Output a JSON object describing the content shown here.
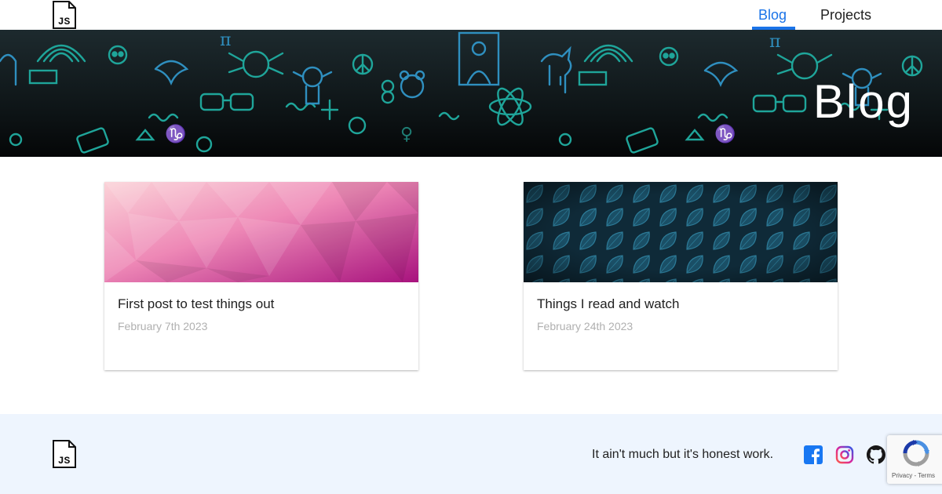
{
  "nav": {
    "logo_text": "JS",
    "links": [
      {
        "label": "Blog",
        "active": true
      },
      {
        "label": "Projects",
        "active": false
      }
    ]
  },
  "hero": {
    "title": "Blog"
  },
  "posts": [
    {
      "title": "First post to test things out",
      "date": "February 7th 2023",
      "thumbnail": "pink-lowpoly-pattern"
    },
    {
      "title": "Things I read and watch",
      "date": "February 24th 2023",
      "thumbnail": "dark-blue-leaf-pattern"
    }
  ],
  "footer": {
    "logo_text": "JS",
    "tagline": "It ain't much but it's honest work.",
    "social": [
      {
        "icon": "facebook-icon",
        "color": "#1877f2"
      },
      {
        "icon": "instagram-icon",
        "color": "#e1306c"
      },
      {
        "icon": "github-icon",
        "color": "#181717"
      }
    ]
  },
  "recaptcha": {
    "privacy": "Privacy",
    "separator": "-",
    "terms": "Terms"
  },
  "colors": {
    "accent": "#1a73e8",
    "footer_bg": "#eef5fe",
    "hero_doodle": "#1fa59a"
  }
}
